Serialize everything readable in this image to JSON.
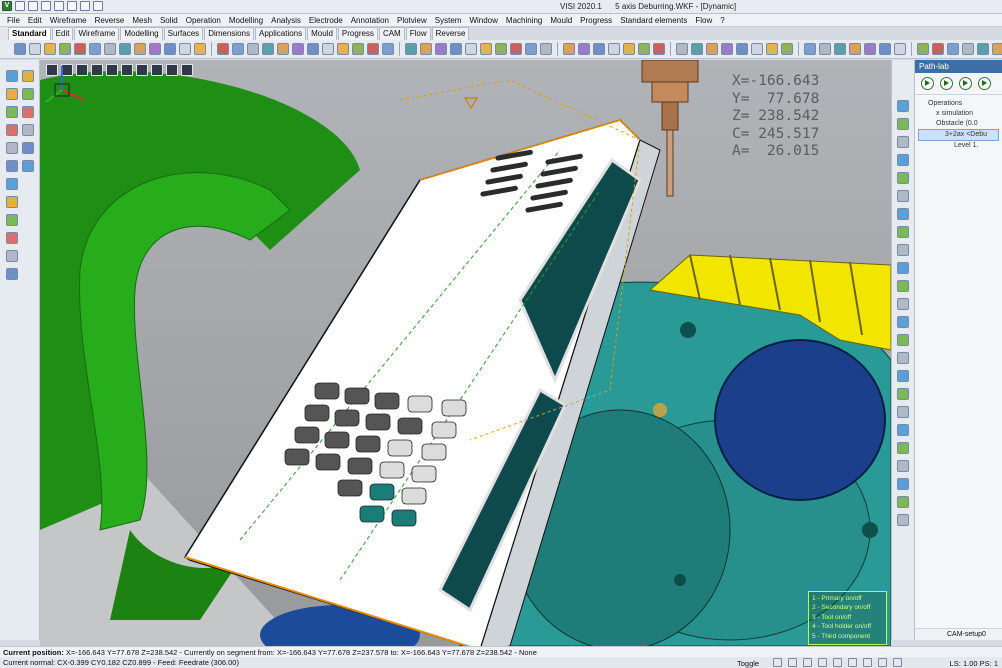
{
  "window": {
    "app_version": "VISI 2020.1",
    "document": "5 axis Deburring.WKF - [Dynamic]"
  },
  "menu": [
    "File",
    "Edit",
    "Wireframe",
    "Reverse",
    "Mesh",
    "Solid",
    "Operation",
    "Modelling",
    "Analysis",
    "Electrode",
    "Annotation",
    "Plotview",
    "System",
    "Window",
    "Machining",
    "Mould",
    "Progress",
    "Standard elements",
    "Flow",
    "?"
  ],
  "tabs": [
    "Standard",
    "Edit",
    "Wireframe",
    "Modelling",
    "Surfaces",
    "Dimensions",
    "Applications",
    "Mould",
    "Progress",
    "CAM",
    "Flow",
    "Reverse"
  ],
  "active_tab": "Standard",
  "coords": {
    "x": "X=-166.643",
    "y": "Y=  77.678",
    "z": "Z= 238.542",
    "c": "C= 245.517",
    "a": "A=  26.015"
  },
  "legend": [
    "1 - Primary on/off",
    "2 - Secondary on/off",
    "3 - Tool on/off",
    "4 - Tool holder on/off",
    "5 - Third component"
  ],
  "path_lab": {
    "title": "Path-lab",
    "tree": [
      {
        "label": "Operations",
        "level": 1
      },
      {
        "label": "x simulation",
        "level": 2
      },
      {
        "label": "Obstacle (0.0",
        "level": 2
      },
      {
        "label": "3+2ax <Debu",
        "level": 3
      },
      {
        "label": "Level 1.",
        "level": 4
      }
    ],
    "bottom": "CAM-setup0"
  },
  "status": {
    "label": "Current position:",
    "position_text": "X=-166.643 Y=77.678 Z=238.542 - Currently on segment from: X=-166.643 Y=77.678 Z=237.578 to: X=-166.643 Y=77.678 Z=238.542 - None",
    "line2": "Current normal: CX-0.399 CY0.182 CZ0.899 - Feed: Feedrate (306.00)",
    "toggle": "Toggle",
    "ls": "LS: 1.00 PS: 1"
  },
  "colors": {
    "green_fixture": "#1f9b16",
    "teal_table": "#2a9a96",
    "blue_disc": "#1b3f8a",
    "yellow_teeth": "#f2e600",
    "part_white": "#ffffff"
  }
}
